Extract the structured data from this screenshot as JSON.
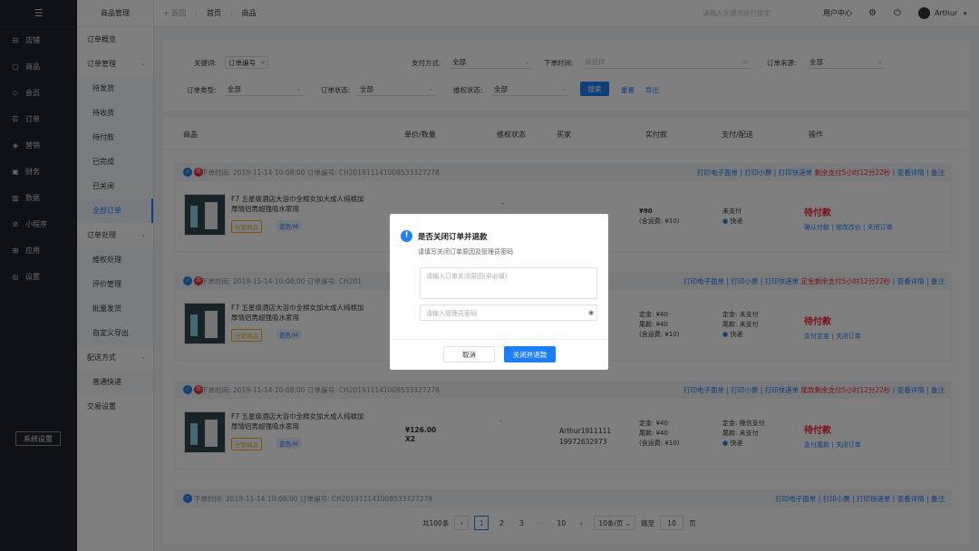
{
  "sidebar": {
    "items": [
      {
        "icon": "store-icon",
        "label": "店铺"
      },
      {
        "icon": "goods-icon",
        "label": "商品"
      },
      {
        "icon": "member-icon",
        "label": "会员"
      },
      {
        "icon": "order-icon",
        "label": "订单"
      },
      {
        "icon": "marketing-icon",
        "label": "营销"
      },
      {
        "icon": "finance-icon",
        "label": "财务"
      },
      {
        "icon": "data-icon",
        "label": "数据"
      },
      {
        "icon": "miniapp-icon",
        "label": "小程序"
      },
      {
        "icon": "apps-icon",
        "label": "应用"
      },
      {
        "icon": "settings-icon",
        "label": "设置"
      }
    ],
    "system_button": "系统设置"
  },
  "subnav": {
    "header": "商品管理",
    "items": [
      {
        "label": "订单概览",
        "type": "group"
      },
      {
        "label": "订单管理",
        "type": "group",
        "expanded": true
      },
      {
        "label": "待发货",
        "type": "child"
      },
      {
        "label": "待收货",
        "type": "child"
      },
      {
        "label": "待付款",
        "type": "child"
      },
      {
        "label": "已完成",
        "type": "child"
      },
      {
        "label": "已关闭",
        "type": "child"
      },
      {
        "label": "全部订单",
        "type": "child",
        "active": true
      },
      {
        "label": "订单处理",
        "type": "group",
        "expanded": true
      },
      {
        "label": "维权处理",
        "type": "child"
      },
      {
        "label": "评价管理",
        "type": "child"
      },
      {
        "label": "批量发货",
        "type": "child"
      },
      {
        "label": "自定义导出",
        "type": "child"
      },
      {
        "label": "配送方式",
        "type": "group",
        "expanded": true
      },
      {
        "label": "普通快递",
        "type": "child"
      },
      {
        "label": "交易设置",
        "type": "group"
      }
    ]
  },
  "topbar": {
    "back": "返回",
    "breadcrumb": [
      "首页",
      "商品"
    ],
    "search_placeholder": "请输入关键词进行搜索",
    "user_center": "用户中心",
    "username": "Arthur"
  },
  "filters": {
    "keyword_label": "关键词:",
    "keyword_value": "订单编号",
    "payment_label": "支付方式:",
    "payment_value": "全部",
    "time_label": "下单时间:",
    "time_placeholder": "请选择",
    "source_label": "订单来源:",
    "source_value": "全部",
    "type_label": "订单类型:",
    "type_value": "全部",
    "status_label": "订单状态:",
    "status_value": "全部",
    "rights_label": "维权状态:",
    "rights_value": "全部",
    "search_btn": "搜索",
    "reset": "重置",
    "export": "导出"
  },
  "table": {
    "headers": [
      "商品",
      "单价/数量",
      "维权状态",
      "买家",
      "实付款",
      "支付/配送",
      "操作"
    ]
  },
  "orders": [
    {
      "meta": "下单时间: 2019-11-14 10:08:00  订单编号: CH201911141008533327278",
      "actions": [
        "打印电子面单",
        "打印小票",
        "打印快递单"
      ],
      "alert": "剩余支付5小时12分22秒",
      "actions2": [
        "查看详情",
        "备注"
      ],
      "product": "F7 五星级酒店大浴巾全棉女加大成人纯棉加厚情侣男超强吸水家用",
      "tag1": "分销商品",
      "tag2": "蓝色/M",
      "price": "",
      "qty": "",
      "rights": "-",
      "buyer1": "",
      "buyer2": "",
      "pay_lines": [
        "¥90",
        "(含运费: ¥10)"
      ],
      "dlv_lines": [
        "未支付",
        "快递"
      ],
      "status": "待付款",
      "ops": [
        "确认付款",
        "修改改价",
        "关闭订单"
      ]
    },
    {
      "meta": "下单时间: 2019-11-14 10:08:00  订单编号: CH201",
      "actions": [
        "打印电子面单",
        "打印小票",
        "打印快递单"
      ],
      "alert": "定金剩余支付5小时12分22秒",
      "actions2": [
        "查看详情",
        "备注"
      ],
      "product": "F7 五星级酒店大浴巾全棉女加大成人纯棉加厚情侣男超强吸水家用",
      "tag1": "分销商品",
      "tag2": "蓝色/M",
      "pay_lines": [
        "定金: ¥40",
        "尾款: ¥40",
        "(含运费: ¥10)"
      ],
      "dlv_lines": [
        "定金: 未支付",
        "尾款: 未支付",
        "快递"
      ],
      "status": "待付款",
      "ops": [
        "支付定金",
        "关闭订单"
      ]
    },
    {
      "meta": "下单时间: 2019-11-14 10:08:00  订单编号: CH201911141008533327278",
      "actions": [
        "打印电子面单",
        "打印小票",
        "打印快递单"
      ],
      "alert": "尾款剩余支付5小时12分22秒",
      "actions2": [
        "查看详情",
        "备注"
      ],
      "product": "F7 五星级酒店大浴巾全棉女加大成人纯棉加厚情侣男超强吸水家用",
      "tag1": "分销商品",
      "tag2": "蓝色/M",
      "price": "¥126.00",
      "qty": "X2",
      "rights": "-",
      "buyer1": "Arthur1911111",
      "buyer2": "19972632973",
      "pay_lines": [
        "定金: ¥40",
        "尾款: ¥40",
        "(含运费: ¥10)"
      ],
      "dlv_lines": [
        "定金: 微信支付",
        "尾款: 未支付",
        "快递"
      ],
      "status": "待付款",
      "ops": [
        "支付尾款",
        "关闭订单"
      ]
    },
    {
      "meta": "下单时间: 2019-11-14 10:08:00  订单编号: CH201911141008533327278",
      "actions": [
        "打印电子面单",
        "打印小票",
        "打印快递单"
      ],
      "actions2": [
        "查看详情",
        "备注"
      ]
    }
  ],
  "pagination": {
    "total": "共100条",
    "pages": [
      "1",
      "2",
      "3",
      "···",
      "10"
    ],
    "per_page": "10条/页",
    "jump_label": "跳至",
    "jump_value": "10",
    "page_unit": "页"
  },
  "modal": {
    "title": "是否关闭订单并退款",
    "subtitle": "请填写关闭订单原因及管理员密码",
    "reason_placeholder": "请输入订单关闭原因(非必填)",
    "password_placeholder": "请输入管理员密码",
    "cancel": "取消",
    "confirm": "关闭并退款"
  },
  "colors": {
    "accent": "#1e7ef5",
    "danger": "#f5222d",
    "sidebar": "#1f2228"
  }
}
